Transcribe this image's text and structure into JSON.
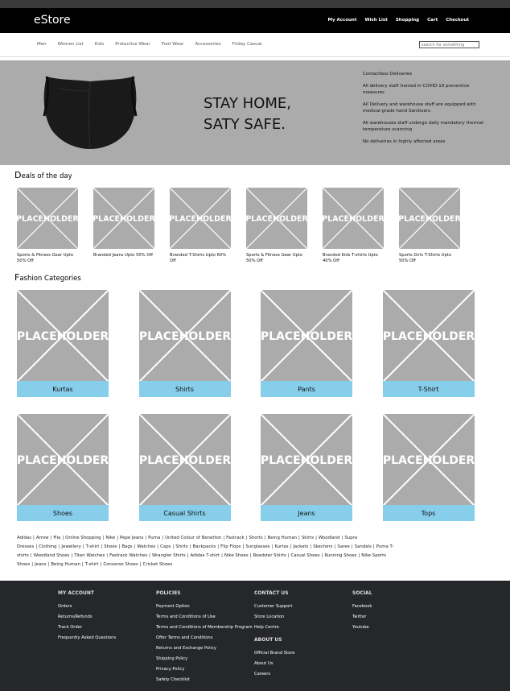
{
  "header": {
    "logo": "eStore",
    "top_links": [
      "My Account",
      "Wish List",
      "Shopping",
      "Cart",
      "Checkout"
    ]
  },
  "categories_nav": [
    "Men",
    "Women List",
    "Kids",
    "Protective Wear",
    "Foot Wear",
    "Accessories",
    "Friday Casual"
  ],
  "search": {
    "placeholder": "search for something"
  },
  "hero": {
    "slogan_line1": "STAY HOME,",
    "slogan_line2": "SATY SAFE.",
    "delivery": [
      "Contactless Deliveries",
      "All delivery staff trained in COVID-19 preventive measures",
      "All Delivery and warehouse staff are equipped with medical-grade hand Sanitizers",
      "All warehouses staff undergo daily mandatory thermal temperature scanning",
      "No deliveries in highly affected areas"
    ]
  },
  "deals": {
    "title_cap": "D",
    "title_rest": "eals of the day",
    "placeholder_text": "PLACEHOLDER",
    "items": [
      "Sports & Fitness Gear Upto 50% Off",
      "Branded Jeans Upto 50% Off",
      "Branded T-Shirts Upto 60% Off",
      "Sports & Fitness Gear Upto 50% Off",
      "Branded Kids T-shirts Upto 40% Off",
      "Sports Girls T-Shirts Upto 50% Off"
    ]
  },
  "fashion": {
    "title_cap": "F",
    "title_rest": "ashion Categories",
    "items": [
      "Kurtas",
      "Shirts",
      "Pants",
      "T-Shirt",
      "Shoes",
      "Casual Shirts",
      "Jeans",
      "Tops"
    ]
  },
  "brands": [
    "Adidas",
    "Arrow",
    "Fila",
    "Online Shopping",
    "Nike",
    "Pepe Jeans",
    "Puma",
    "United Colour of Benetton",
    "Fastrack",
    "Shorts",
    "Being Human",
    "Skirts",
    "Woodland",
    "Supra Dresses",
    "Clothing",
    "Jewellery",
    "T-shirt",
    "Shoes",
    "Bags",
    "Watches",
    "Caps",
    "Shirts",
    "Backpacks",
    "Flip Flops",
    "Sunglasses",
    "Kurtas",
    "Jackets",
    "Skechers",
    "Saree",
    "Sandals",
    "Puma T-shirts",
    "Woodland Shoes",
    "Titan Watches",
    "Fastrack Watches",
    "Wrangler Shirts",
    "Adidas T-shirt",
    "Nike Shoes",
    "Roadster Shirts",
    "Casual Shoes",
    "Running Shoes",
    "Nike Sports Shoes",
    "Jeans",
    "Being Human",
    "T-shirt",
    "Converse Shoes",
    "Cricket Shoes"
  ],
  "footer": {
    "my_account": {
      "title": "MY ACCOUNT",
      "links": [
        "Orders",
        "Returns/Refunds",
        "Track Order",
        "Frequently Asked Questions"
      ]
    },
    "policies": {
      "title": "POLICIES",
      "links": [
        "Payment Option",
        "Terms and Conditions of Use",
        "Terms and Conditions of Membership Program",
        "Offer Terms and Conditions",
        "Returns and Exchange Policy",
        "Shipping Policy",
        "Privacy Policy",
        "Safety Checklist"
      ]
    },
    "contact_us": {
      "title": "CONTACT US",
      "links": [
        "Customer Support",
        "Store Location",
        "Help Centre"
      ]
    },
    "about_us": {
      "title": "ABOUT US",
      "links": [
        "Official Brand Store",
        "About Us",
        "Careers"
      ]
    },
    "social": {
      "title": "SOCIAL",
      "links": [
        "Facebook",
        "Twitter",
        "Youtube"
      ]
    }
  }
}
